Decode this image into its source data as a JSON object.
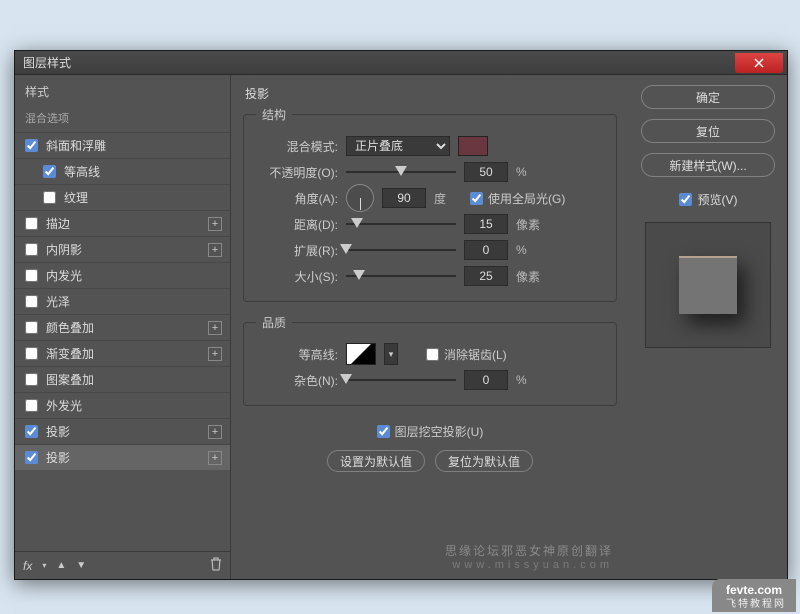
{
  "dialog": {
    "title": "图层样式"
  },
  "sidebar": {
    "head": "样式",
    "sub": "混合选项",
    "items": [
      {
        "label": "斜面和浮雕",
        "checked": true,
        "indent": false,
        "plus": false
      },
      {
        "label": "等高线",
        "checked": true,
        "indent": true,
        "plus": false
      },
      {
        "label": "纹理",
        "checked": false,
        "indent": true,
        "plus": false
      },
      {
        "label": "描边",
        "checked": false,
        "indent": false,
        "plus": true
      },
      {
        "label": "内阴影",
        "checked": false,
        "indent": false,
        "plus": true
      },
      {
        "label": "内发光",
        "checked": false,
        "indent": false,
        "plus": false
      },
      {
        "label": "光泽",
        "checked": false,
        "indent": false,
        "plus": false
      },
      {
        "label": "颜色叠加",
        "checked": false,
        "indent": false,
        "plus": true
      },
      {
        "label": "渐变叠加",
        "checked": false,
        "indent": false,
        "plus": true
      },
      {
        "label": "图案叠加",
        "checked": false,
        "indent": false,
        "plus": false
      },
      {
        "label": "外发光",
        "checked": false,
        "indent": false,
        "plus": false
      },
      {
        "label": "投影",
        "checked": true,
        "indent": false,
        "plus": true
      },
      {
        "label": "投影",
        "checked": true,
        "indent": false,
        "plus": true,
        "active": true
      }
    ],
    "fx": "fx"
  },
  "main": {
    "title": "投影",
    "structure": {
      "legend": "结构",
      "blend_mode_label": "混合模式:",
      "blend_mode_value": "正片叠底",
      "opacity_label": "不透明度(O):",
      "opacity_value": "50",
      "opacity_unit": "%",
      "angle_label": "角度(A):",
      "angle_value": "90",
      "angle_unit": "度",
      "global_light_label": "使用全局光(G)",
      "global_light_checked": true,
      "distance_label": "距离(D):",
      "distance_value": "15",
      "distance_unit": "像素",
      "spread_label": "扩展(R):",
      "spread_value": "0",
      "spread_unit": "%",
      "size_label": "大小(S):",
      "size_value": "25",
      "size_unit": "像素"
    },
    "quality": {
      "legend": "品质",
      "contour_label": "等高线:",
      "antialias_label": "消除锯齿(L)",
      "antialias_checked": false,
      "noise_label": "杂色(N):",
      "noise_value": "0",
      "noise_unit": "%"
    },
    "knockout_label": "图层挖空投影(U)",
    "knockout_checked": true,
    "btn_default": "设置为默认值",
    "btn_reset": "复位为默认值"
  },
  "right": {
    "ok": "确定",
    "cancel": "复位",
    "newstyle": "新建样式(W)...",
    "preview_label": "预览(V)",
    "preview_checked": true
  },
  "watermark": {
    "line1": "思缘论坛邪恶女神原创翻译",
    "line2": "www.missyuan.com"
  },
  "logo": {
    "brand": "fevte.com",
    "sub": "飞特教程网"
  }
}
